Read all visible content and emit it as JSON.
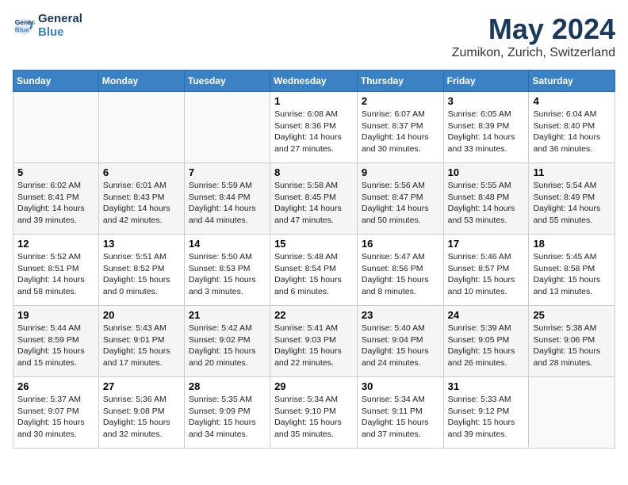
{
  "header": {
    "logo_line1": "General",
    "logo_line2": "Blue",
    "title": "May 2024",
    "subtitle": "Zumikon, Zurich, Switzerland"
  },
  "days_of_week": [
    "Sunday",
    "Monday",
    "Tuesday",
    "Wednesday",
    "Thursday",
    "Friday",
    "Saturday"
  ],
  "weeks": [
    [
      {
        "day": "",
        "info": ""
      },
      {
        "day": "",
        "info": ""
      },
      {
        "day": "",
        "info": ""
      },
      {
        "day": "1",
        "info": "Sunrise: 6:08 AM\nSunset: 8:36 PM\nDaylight: 14 hours\nand 27 minutes."
      },
      {
        "day": "2",
        "info": "Sunrise: 6:07 AM\nSunset: 8:37 PM\nDaylight: 14 hours\nand 30 minutes."
      },
      {
        "day": "3",
        "info": "Sunrise: 6:05 AM\nSunset: 8:39 PM\nDaylight: 14 hours\nand 33 minutes."
      },
      {
        "day": "4",
        "info": "Sunrise: 6:04 AM\nSunset: 8:40 PM\nDaylight: 14 hours\nand 36 minutes."
      }
    ],
    [
      {
        "day": "5",
        "info": "Sunrise: 6:02 AM\nSunset: 8:41 PM\nDaylight: 14 hours\nand 39 minutes."
      },
      {
        "day": "6",
        "info": "Sunrise: 6:01 AM\nSunset: 8:43 PM\nDaylight: 14 hours\nand 42 minutes."
      },
      {
        "day": "7",
        "info": "Sunrise: 5:59 AM\nSunset: 8:44 PM\nDaylight: 14 hours\nand 44 minutes."
      },
      {
        "day": "8",
        "info": "Sunrise: 5:58 AM\nSunset: 8:45 PM\nDaylight: 14 hours\nand 47 minutes."
      },
      {
        "day": "9",
        "info": "Sunrise: 5:56 AM\nSunset: 8:47 PM\nDaylight: 14 hours\nand 50 minutes."
      },
      {
        "day": "10",
        "info": "Sunrise: 5:55 AM\nSunset: 8:48 PM\nDaylight: 14 hours\nand 53 minutes."
      },
      {
        "day": "11",
        "info": "Sunrise: 5:54 AM\nSunset: 8:49 PM\nDaylight: 14 hours\nand 55 minutes."
      }
    ],
    [
      {
        "day": "12",
        "info": "Sunrise: 5:52 AM\nSunset: 8:51 PM\nDaylight: 14 hours\nand 58 minutes."
      },
      {
        "day": "13",
        "info": "Sunrise: 5:51 AM\nSunset: 8:52 PM\nDaylight: 15 hours\nand 0 minutes."
      },
      {
        "day": "14",
        "info": "Sunrise: 5:50 AM\nSunset: 8:53 PM\nDaylight: 15 hours\nand 3 minutes."
      },
      {
        "day": "15",
        "info": "Sunrise: 5:48 AM\nSunset: 8:54 PM\nDaylight: 15 hours\nand 6 minutes."
      },
      {
        "day": "16",
        "info": "Sunrise: 5:47 AM\nSunset: 8:56 PM\nDaylight: 15 hours\nand 8 minutes."
      },
      {
        "day": "17",
        "info": "Sunrise: 5:46 AM\nSunset: 8:57 PM\nDaylight: 15 hours\nand 10 minutes."
      },
      {
        "day": "18",
        "info": "Sunrise: 5:45 AM\nSunset: 8:58 PM\nDaylight: 15 hours\nand 13 minutes."
      }
    ],
    [
      {
        "day": "19",
        "info": "Sunrise: 5:44 AM\nSunset: 8:59 PM\nDaylight: 15 hours\nand 15 minutes."
      },
      {
        "day": "20",
        "info": "Sunrise: 5:43 AM\nSunset: 9:01 PM\nDaylight: 15 hours\nand 17 minutes."
      },
      {
        "day": "21",
        "info": "Sunrise: 5:42 AM\nSunset: 9:02 PM\nDaylight: 15 hours\nand 20 minutes."
      },
      {
        "day": "22",
        "info": "Sunrise: 5:41 AM\nSunset: 9:03 PM\nDaylight: 15 hours\nand 22 minutes."
      },
      {
        "day": "23",
        "info": "Sunrise: 5:40 AM\nSunset: 9:04 PM\nDaylight: 15 hours\nand 24 minutes."
      },
      {
        "day": "24",
        "info": "Sunrise: 5:39 AM\nSunset: 9:05 PM\nDaylight: 15 hours\nand 26 minutes."
      },
      {
        "day": "25",
        "info": "Sunrise: 5:38 AM\nSunset: 9:06 PM\nDaylight: 15 hours\nand 28 minutes."
      }
    ],
    [
      {
        "day": "26",
        "info": "Sunrise: 5:37 AM\nSunset: 9:07 PM\nDaylight: 15 hours\nand 30 minutes."
      },
      {
        "day": "27",
        "info": "Sunrise: 5:36 AM\nSunset: 9:08 PM\nDaylight: 15 hours\nand 32 minutes."
      },
      {
        "day": "28",
        "info": "Sunrise: 5:35 AM\nSunset: 9:09 PM\nDaylight: 15 hours\nand 34 minutes."
      },
      {
        "day": "29",
        "info": "Sunrise: 5:34 AM\nSunset: 9:10 PM\nDaylight: 15 hours\nand 35 minutes."
      },
      {
        "day": "30",
        "info": "Sunrise: 5:34 AM\nSunset: 9:11 PM\nDaylight: 15 hours\nand 37 minutes."
      },
      {
        "day": "31",
        "info": "Sunrise: 5:33 AM\nSunset: 9:12 PM\nDaylight: 15 hours\nand 39 minutes."
      },
      {
        "day": "",
        "info": ""
      }
    ]
  ]
}
